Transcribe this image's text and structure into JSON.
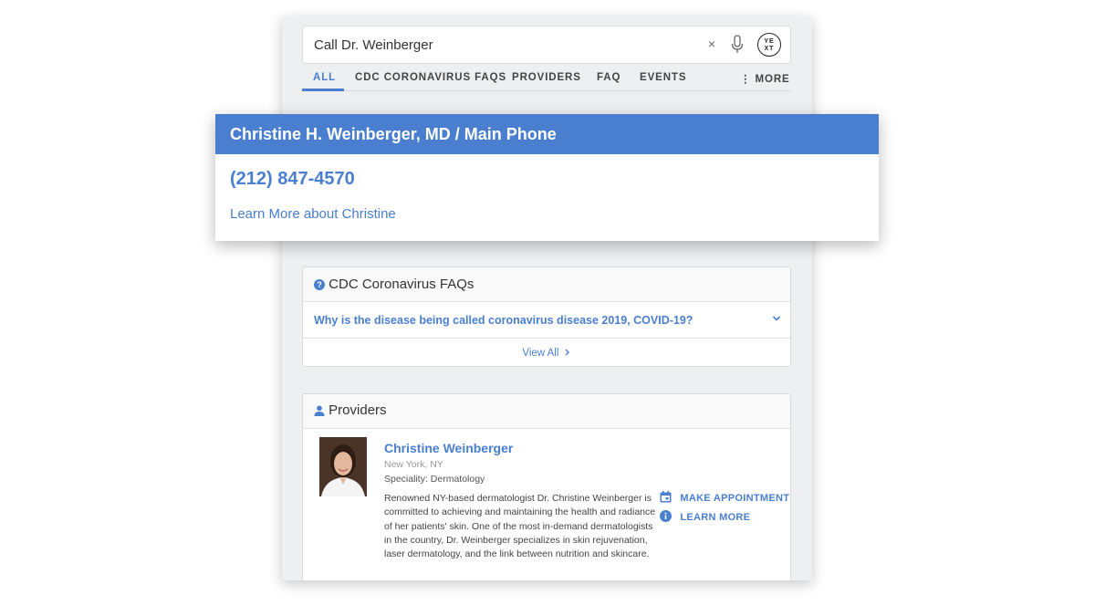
{
  "search": {
    "query": "Call Dr. Weinberger",
    "clear_glyph": "×",
    "logo_text": "YE XT"
  },
  "nav": {
    "tabs": [
      {
        "label": "ALL",
        "active": true
      },
      {
        "label": "CDC CORONAVIRUS FAQS"
      },
      {
        "label": "PROVIDERS"
      },
      {
        "label": "FAQ"
      },
      {
        "label": "EVENTS"
      }
    ],
    "more_label": "⋮ MORE"
  },
  "direct_answer": {
    "title": "Christine H. Weinberger, MD / Main Phone",
    "phone": "(212) 847-4570",
    "link": "Learn More about Christine"
  },
  "faqs": {
    "title": "CDC Coronavirus FAQs",
    "icon_glyph": "?",
    "question": "Why is the disease being called coronavirus disease 2019, COVID-19?",
    "view_all": "View All"
  },
  "providers": {
    "title": "Providers",
    "item": {
      "name": "Christine Weinberger",
      "location": "New York, NY",
      "specialty": "Speciality: Dermatology",
      "description": "Renowned NY-based dermatologist Dr. Christine Weinberger is committed to achieving and maintaining the health and radiance of her patients' skin. One of the most in-demand dermatologists in the country, Dr. Weinberger specializes in skin rejuvenation, laser dermatology, and the link between nutrition and skincare.",
      "actions": {
        "appointment": "MAKE APPOINTMENT",
        "learn_more": "LEARN MORE"
      }
    }
  },
  "colors": {
    "accent": "#4a7fd0",
    "panel_bg": "#eeeff1"
  }
}
